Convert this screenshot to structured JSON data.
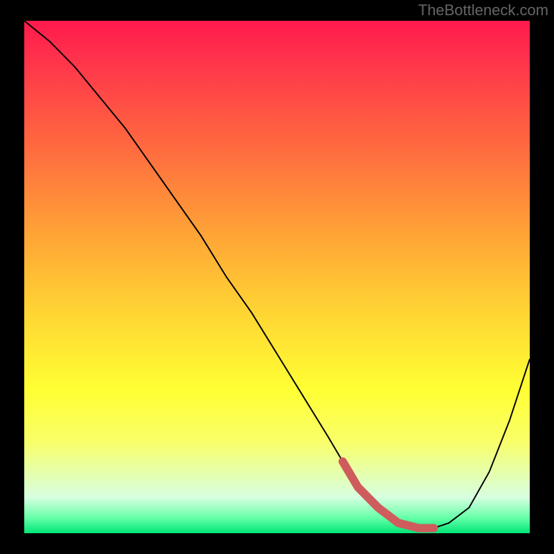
{
  "watermark": "TheBottleneck.com",
  "chart_data": {
    "type": "line",
    "title": "",
    "xlabel": "",
    "ylabel": "",
    "xlim": [
      0,
      100
    ],
    "ylim": [
      0,
      100
    ],
    "x": [
      0,
      5,
      10,
      15,
      20,
      25,
      30,
      35,
      40,
      45,
      50,
      55,
      60,
      63,
      66,
      70,
      74,
      78,
      81,
      84,
      88,
      92,
      96,
      100
    ],
    "curve": [
      100,
      96,
      91,
      85,
      79,
      72,
      65,
      58,
      50,
      43,
      35,
      27,
      19,
      14,
      9,
      5,
      2,
      1,
      1,
      2,
      5,
      12,
      22,
      34
    ],
    "accent_segment": {
      "x_start": 63,
      "x_end": 81,
      "color": "#cf5c5c",
      "stroke_width": 12
    },
    "line_color": "#000000",
    "line_width": 2,
    "background_gradient": [
      {
        "stop": 0.0,
        "color": "#ff1a4d"
      },
      {
        "stop": 0.1,
        "color": "#ff3b4a"
      },
      {
        "stop": 0.25,
        "color": "#ff6b3f"
      },
      {
        "stop": 0.42,
        "color": "#ffa536"
      },
      {
        "stop": 0.58,
        "color": "#ffd833"
      },
      {
        "stop": 0.72,
        "color": "#ffff33"
      },
      {
        "stop": 0.82,
        "color": "#f9ff68"
      },
      {
        "stop": 0.93,
        "color": "#d7ffe0"
      },
      {
        "stop": 0.97,
        "color": "#66ffa8"
      },
      {
        "stop": 1.0,
        "color": "#00e676"
      }
    ]
  }
}
